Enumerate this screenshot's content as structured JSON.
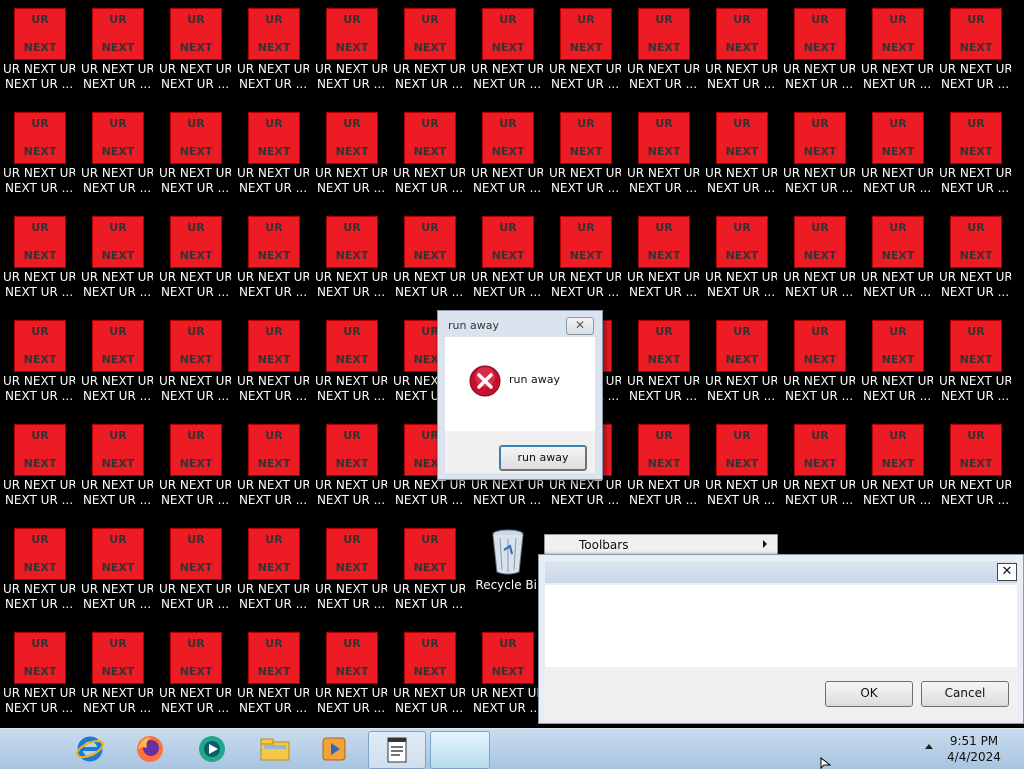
{
  "desktop": {
    "tile_top": "UR",
    "tile_bottom": "NEXT",
    "caption_line1": "UR NEXT UR",
    "caption_line2": "NEXT UR ...",
    "caption_line1_first": "UR NEXT UR.",
    "recycle_bin_label": "Recycle Bin"
  },
  "message_box": {
    "title": "run away",
    "text": "run away",
    "button_label": "run away",
    "icon": "error-icon"
  },
  "context_menu": {
    "item_label": "Toolbars"
  },
  "dialog": {
    "ok_label": "OK",
    "cancel_label": "Cancel"
  },
  "taskbar": {
    "apps": [
      "internet-explorer-icon",
      "firefox-icon",
      "media-app-icon",
      "file-explorer-icon",
      "media-player-icon",
      "notepad-icon",
      "blank-window"
    ],
    "time": "9:51 PM",
    "date": "4/4/2024"
  },
  "colors": {
    "tile_red": "#ed1c24",
    "desktop_bg": "#000000",
    "taskbar_blue": "#b9d1ea"
  }
}
